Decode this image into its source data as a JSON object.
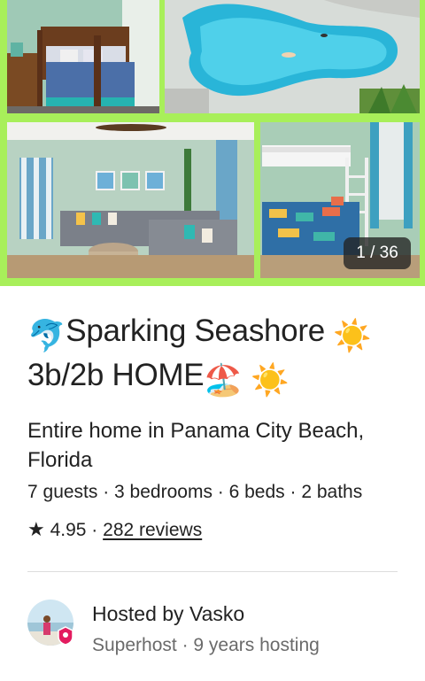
{
  "gallery": {
    "photo_counter": "1 / 36",
    "accent_color": "#a8ef5a"
  },
  "listing": {
    "title_emoji_lead": "🐬",
    "title_line1_text": "Sparking Seashore",
    "title_line1_emoji": "☀️",
    "title_line2_text": "3b/2b HOME",
    "title_line2_emoji_a": "🏖️",
    "title_line2_emoji_b": "☀️",
    "subtitle": "Entire home in Panama City Beach, Florida",
    "details": "7 guests · 3 bedrooms · 6 beds · 2 baths",
    "rating_star": "★",
    "rating_score": "4.95",
    "rating_separator": "·",
    "reviews_link": "282 reviews"
  },
  "host": {
    "hosted_by": "Hosted by Vasko",
    "meta": "Superhost · 9 years hosting",
    "badge_icon": "superhost-badge-icon",
    "badge_color": "#e31c5f"
  }
}
